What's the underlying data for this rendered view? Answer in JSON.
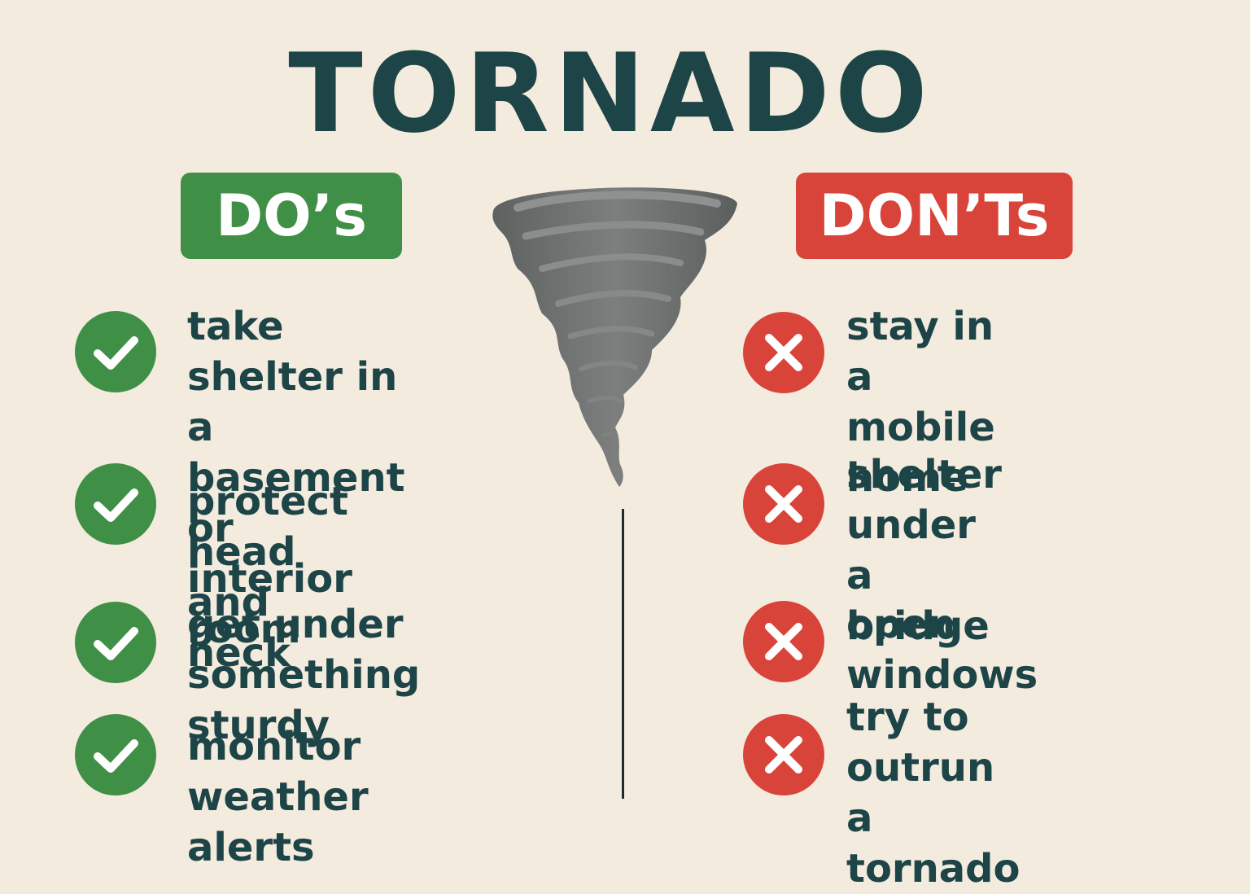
{
  "title": "TORNADO",
  "colors": {
    "background": "#f4ebdf",
    "text": "#1d4447",
    "do_green": "#3f8f46",
    "dont_red": "#d9443a",
    "tornado_gray": "#6b6e6c"
  },
  "dos": {
    "heading": "DO’s",
    "icon": "check-icon",
    "items": [
      "take shelter in\na basement or\ninterior room",
      "protect head and\nneck",
      "get under something\nsturdy",
      "monitor weather\nalerts"
    ]
  },
  "donts": {
    "heading": "DON’Ts",
    "icon": "x-icon",
    "items": [
      "stay in a\nmobile home",
      "shelter under\na bridge",
      "open windows",
      "try to outrun\na tornado"
    ]
  },
  "illustration": {
    "icon": "tornado-icon"
  }
}
